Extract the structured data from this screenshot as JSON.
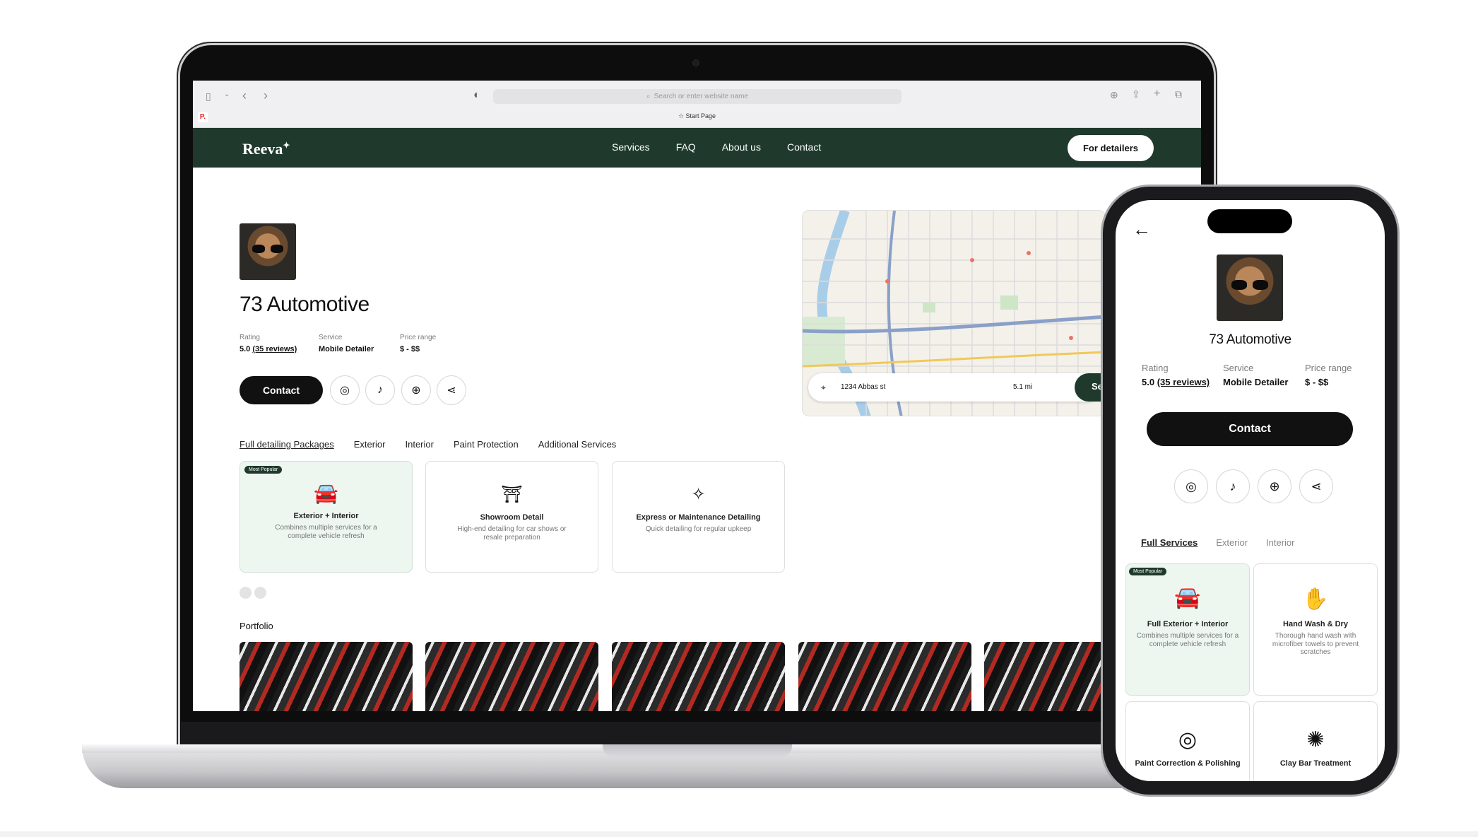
{
  "browser": {
    "search_placeholder": "Search or enter website name",
    "start_page_label": "Start Page",
    "pinned_tab_letter": "P."
  },
  "site": {
    "logo": "Reeva",
    "nav": [
      "Services",
      "FAQ",
      "About us",
      "Contact"
    ],
    "cta": "For detailers",
    "colors": {
      "brand": "#1f3a2c",
      "popular_card": "#eef6f0"
    }
  },
  "business": {
    "name": "73 Automotive",
    "rating_label": "Rating",
    "rating_value": "5.0",
    "reviews_link": "(35 reviews)",
    "service_label": "Service",
    "service_value": "Mobile Detailer",
    "price_label": "Price range",
    "price_value": "$ - $$"
  },
  "actions": {
    "contact": "Contact",
    "icons": [
      "instagram-icon",
      "tiktok-icon",
      "globe-icon",
      "share-icon"
    ]
  },
  "desktop_tabs": [
    "Full detailing Packages",
    "Exterior",
    "Interior",
    "Paint Protection",
    "Additional Services"
  ],
  "desktop_cards": [
    {
      "badge": "Most Popular",
      "title": "Exterior + Interior",
      "desc": "Combines multiple services for a complete vehicle refresh",
      "icon": "car-wash-icon"
    },
    {
      "title": "Showroom Detail",
      "desc": "High-end detailing for car shows or resale preparation",
      "icon": "showroom-icon"
    },
    {
      "title": "Express or Maintenance Detailing",
      "desc": "Quick detailing for regular upkeep",
      "icon": "sparkles-icon"
    }
  ],
  "portfolio": {
    "title": "Portfolio",
    "count": 5
  },
  "map": {
    "address": "1234 Abbas st",
    "distance": "5.1 mi",
    "button": "Se"
  },
  "mobile_tabs": [
    "Full Services",
    "Exterior",
    "Interior"
  ],
  "mobile_cards": [
    {
      "badge": "Most Popular",
      "title": "Full Exterior + Interior",
      "desc": "Combines multiple services for a complete vehicle refresh",
      "icon": "car-wash-icon"
    },
    {
      "title": "Hand Wash & Dry",
      "desc": "Thorough hand wash with microfiber towels to prevent scratches",
      "icon": "hand-wash-icon"
    },
    {
      "title": "Paint Correction & Polishing",
      "icon": "polish-swirl-icon"
    },
    {
      "title": "Clay Bar Treatment",
      "icon": "clay-bar-icon"
    }
  ]
}
